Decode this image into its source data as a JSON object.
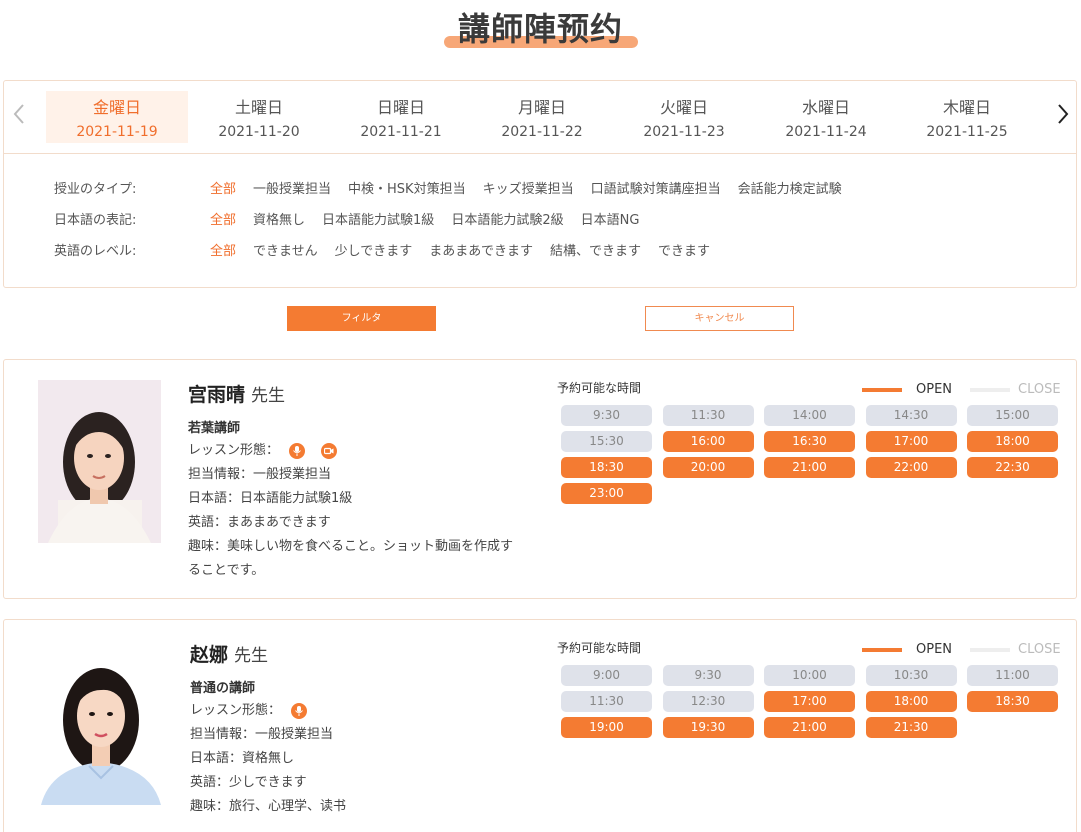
{
  "page_title": "講師陣预约",
  "days": [
    {
      "name": "金曜日",
      "date": "2021-11-19",
      "active": true
    },
    {
      "name": "土曜日",
      "date": "2021-11-20",
      "active": false
    },
    {
      "name": "日曜日",
      "date": "2021-11-21",
      "active": false
    },
    {
      "name": "月曜日",
      "date": "2021-11-22",
      "active": false
    },
    {
      "name": "火曜日",
      "date": "2021-11-23",
      "active": false
    },
    {
      "name": "水曜日",
      "date": "2021-11-24",
      "active": false
    },
    {
      "name": "木曜日",
      "date": "2021-11-25",
      "active": false
    }
  ],
  "nav": {
    "prev_icon": "chevron-left-icon",
    "next_icon": "chevron-right-icon"
  },
  "filters": [
    {
      "label": "授业のタイプ:",
      "options": [
        "全部",
        "一般授業担当",
        "中検・HSK対策担当",
        "キッズ授業担当",
        "口語試験対策講座担当",
        "会話能力検定試験"
      ],
      "selected": "全部"
    },
    {
      "label": "日本語の表記:",
      "options": [
        "全部",
        "資格無し",
        "日本語能力試験1級",
        "日本語能力試験2級",
        "日本語NG"
      ],
      "selected": "全部"
    },
    {
      "label": "英語のレベル:",
      "options": [
        "全部",
        "できません",
        "少しできます",
        "まあまあできます",
        "結構、できます",
        "できます"
      ],
      "selected": "全部"
    }
  ],
  "buttons": {
    "filter": "フィルタ",
    "cancel": "キャンセル"
  },
  "accent_color": "#f47b32",
  "legend": {
    "open": "OPEN",
    "close": "CLOSE"
  },
  "schedule_title": "予約可能な時間",
  "teachers": [
    {
      "name": "宫雨晴",
      "suffix": "先生",
      "rank": "若葉講師",
      "lesson_label": "レッスン形態：",
      "lesson_icons": [
        "microphone-icon",
        "video-camera-icon"
      ],
      "subject": "担当情報：一般授業担当",
      "japanese": "日本語：日本語能力試験1級",
      "english": "英語：まあまあできます",
      "hobby": "趣味：美味しい物を食べること。ショット動画を作成することです。",
      "slots": [
        {
          "time": "9:30",
          "status": "close"
        },
        {
          "time": "11:30",
          "status": "close"
        },
        {
          "time": "14:00",
          "status": "close"
        },
        {
          "time": "14:30",
          "status": "close"
        },
        {
          "time": "15:00",
          "status": "close"
        },
        {
          "time": "15:30",
          "status": "close"
        },
        {
          "time": "16:00",
          "status": "open"
        },
        {
          "time": "16:30",
          "status": "open"
        },
        {
          "time": "17:00",
          "status": "open"
        },
        {
          "time": "18:00",
          "status": "open"
        },
        {
          "time": "18:30",
          "status": "open"
        },
        {
          "time": "20:00",
          "status": "open"
        },
        {
          "time": "21:00",
          "status": "open"
        },
        {
          "time": "22:00",
          "status": "open"
        },
        {
          "time": "22:30",
          "status": "open"
        },
        {
          "time": "23:00",
          "status": "open"
        }
      ]
    },
    {
      "name": "赵娜",
      "suffix": "先生",
      "rank": "普通の講師",
      "lesson_label": "レッスン形態：",
      "lesson_icons": [
        "microphone-icon"
      ],
      "subject": "担当情報：一般授業担当",
      "japanese": "日本語：資格無し",
      "english": "英語：少しできます",
      "hobby": "趣味：旅行、心理学、读书",
      "slots": [
        {
          "time": "9:00",
          "status": "close"
        },
        {
          "time": "9:30",
          "status": "close"
        },
        {
          "time": "10:00",
          "status": "close"
        },
        {
          "time": "10:30",
          "status": "close"
        },
        {
          "time": "11:00",
          "status": "close"
        },
        {
          "time": "11:30",
          "status": "close"
        },
        {
          "time": "12:30",
          "status": "close"
        },
        {
          "time": "17:00",
          "status": "open"
        },
        {
          "time": "18:00",
          "status": "open"
        },
        {
          "time": "18:30",
          "status": "open"
        },
        {
          "time": "19:00",
          "status": "open"
        },
        {
          "time": "19:30",
          "status": "open"
        },
        {
          "time": "21:00",
          "status": "open"
        },
        {
          "time": "21:30",
          "status": "open"
        }
      ]
    }
  ]
}
